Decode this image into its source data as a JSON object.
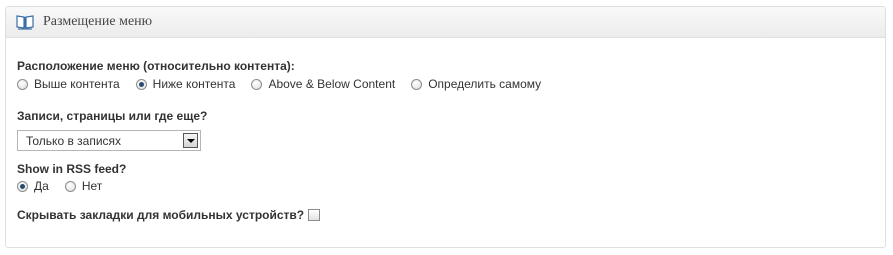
{
  "panel": {
    "title": "Размещение меню"
  },
  "menu_position": {
    "label": "Расположение меню (относительно контента):",
    "options": [
      {
        "label": "Выше контента",
        "checked": false
      },
      {
        "label": "Ниже контента",
        "checked": true
      },
      {
        "label": "Above & Below Content",
        "checked": false
      },
      {
        "label": "Определить самому",
        "checked": false
      }
    ]
  },
  "where": {
    "label": "Записи, страницы или где еще?",
    "selected": "Только в записях"
  },
  "rss": {
    "label": "Show in RSS feed?",
    "options": [
      {
        "label": "Да",
        "checked": true
      },
      {
        "label": "Нет",
        "checked": false
      }
    ]
  },
  "mobile": {
    "label": "Скрывать закладки для мобильных устройств?",
    "checked": false
  }
}
